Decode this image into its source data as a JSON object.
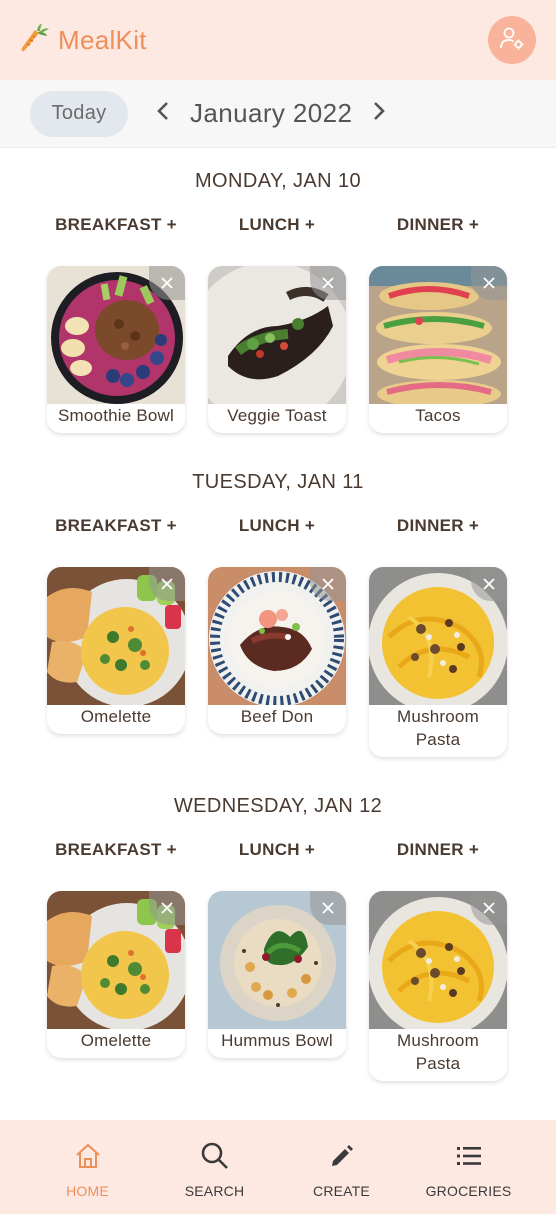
{
  "app": {
    "name": "MealKit"
  },
  "date_bar": {
    "today_label": "Today",
    "month_label": "January 2022"
  },
  "meal_types": {
    "breakfast": "BREAKFAST",
    "lunch": "LUNCH",
    "dinner": "DINNER",
    "add_symbol": "+"
  },
  "days": [
    {
      "title": "MONDAY, JAN 10",
      "meals": [
        {
          "label": "Smoothie Bowl",
          "photo": "smoothie-bowl"
        },
        {
          "label": "Veggie Toast",
          "photo": "veggie-toast"
        },
        {
          "label": "Tacos",
          "photo": "tacos"
        }
      ]
    },
    {
      "title": "TUESDAY, JAN 11",
      "meals": [
        {
          "label": "Omelette",
          "photo": "omelette"
        },
        {
          "label": "Beef Don",
          "photo": "beef-don"
        },
        {
          "label": "Mushroom Pasta",
          "photo": "mushroom-pasta"
        }
      ]
    },
    {
      "title": "WEDNESDAY, JAN 12",
      "meals": [
        {
          "label": "Omelette",
          "photo": "omelette"
        },
        {
          "label": "Hummus Bowl",
          "photo": "hummus-bowl"
        },
        {
          "label": "Mushroom Pasta",
          "photo": "mushroom-pasta"
        }
      ]
    }
  ],
  "bottom_nav": [
    {
      "label": "HOME",
      "icon": "home-icon",
      "active": true
    },
    {
      "label": "SEARCH",
      "icon": "search-icon",
      "active": false
    },
    {
      "label": "CREATE",
      "icon": "pencil-icon",
      "active": false
    },
    {
      "label": "GROCERIES",
      "icon": "list-icon",
      "active": false
    }
  ],
  "colors": {
    "accent": "#ee8f5a",
    "header_bg": "#fde9e2",
    "profile_bg": "#f8b39a",
    "today_bg": "#e3e8ee"
  }
}
